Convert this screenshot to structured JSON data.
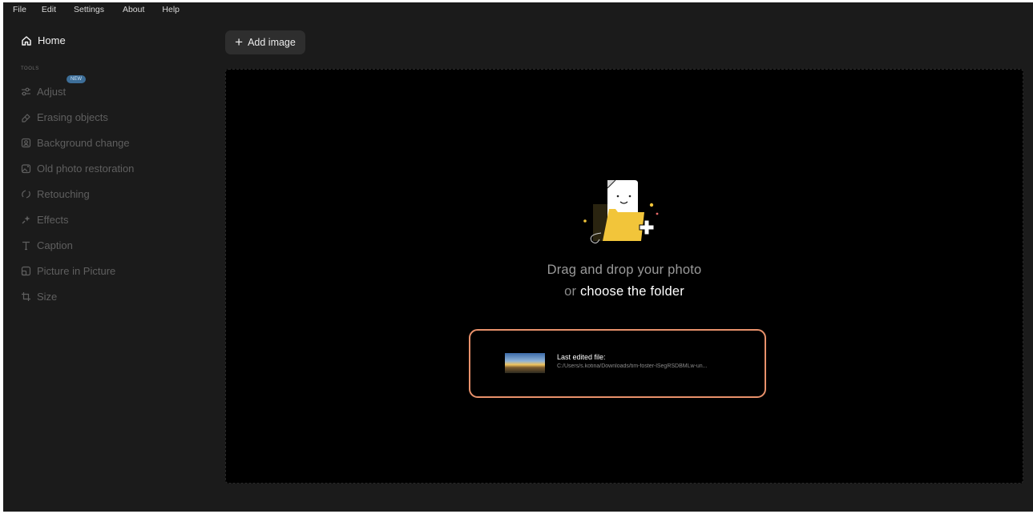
{
  "menu": [
    "File",
    "Edit",
    "Settings",
    "About",
    "Help"
  ],
  "sidebar": {
    "home_label": "Home",
    "tools_label": "TOOLS",
    "new_badge": "NEW",
    "tools": [
      {
        "label": "Adjust",
        "icon": "sliders-icon"
      },
      {
        "label": "Erasing objects",
        "icon": "eraser-icon"
      },
      {
        "label": "Background change",
        "icon": "portrait-icon"
      },
      {
        "label": "Old photo restoration",
        "icon": "photo-restore-icon"
      },
      {
        "label": "Retouching",
        "icon": "retouch-icon"
      },
      {
        "label": "Effects",
        "icon": "magic-wand-icon"
      },
      {
        "label": "Caption",
        "icon": "text-icon"
      },
      {
        "label": "Picture in Picture",
        "icon": "pip-icon"
      },
      {
        "label": "Size",
        "icon": "crop-icon"
      }
    ]
  },
  "toolbar": {
    "add_image_label": "Add image"
  },
  "dropzone": {
    "line1": "Drag and drop your photo",
    "line2_prefix": "or",
    "line2_link": "choose the folder"
  },
  "last_file": {
    "title": "Last edited file:",
    "path": "C:/Users/s.kotina/Downloads/tim-foster-lSegRSDBMLw-un..."
  },
  "colors": {
    "background": "#1b1b1b",
    "dropzone": "#000000",
    "highlight_border": "#e8916b",
    "badge": "#3d6e98",
    "folder_yellow": "#f2c53a"
  }
}
